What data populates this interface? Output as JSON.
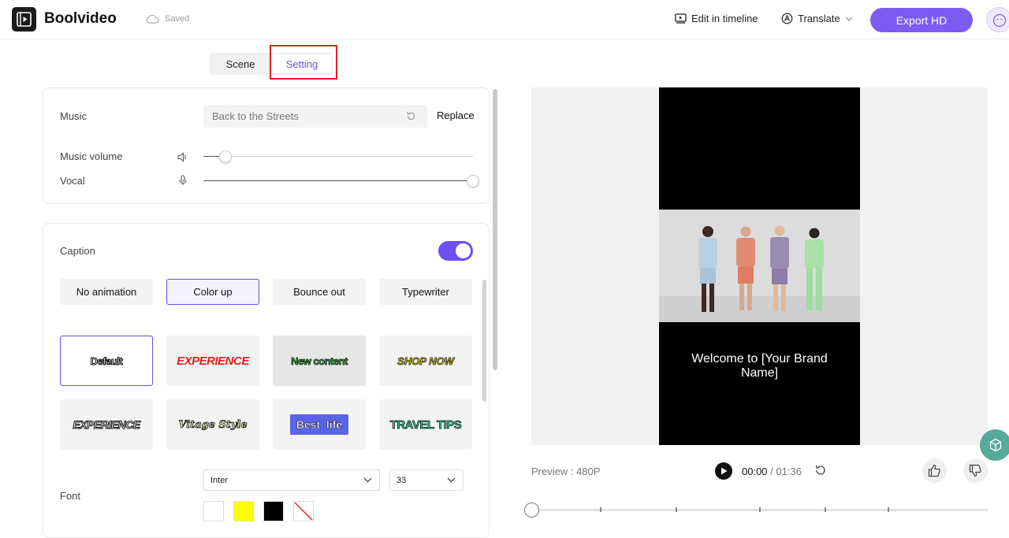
{
  "app": {
    "name": "Boolvideo",
    "save_status": "Saved"
  },
  "header": {
    "edit_timeline": "Edit in timeline",
    "translate": "Translate",
    "export": "Export HD"
  },
  "tabs": {
    "scene": "Scene",
    "setting": "Setting",
    "active": "Setting"
  },
  "music": {
    "label": "Music",
    "track": "Back to the Streets",
    "replace": "Replace",
    "volume_label": "Music volume",
    "volume_level": 0.08,
    "vocal_label": "Vocal",
    "vocal_level": 1.0
  },
  "caption": {
    "label": "Caption",
    "enabled": true,
    "animations": [
      "No animation",
      "Color up",
      "Bounce out",
      "Typewriter"
    ],
    "selected_animation": "Color up",
    "styles": [
      "Default",
      "EXPERIENCE",
      "New content",
      "SHOP NOW",
      "EXPERIENCE",
      "Vitage Style",
      "Best  life",
      "TRAVEL TIPS"
    ],
    "selected_style": "Default",
    "font_label": "Font",
    "font": "Inter",
    "font_size": "33",
    "colors": [
      "#ffffff",
      "#ffff00",
      "#000000",
      "none"
    ]
  },
  "preview": {
    "caption_text": "Welcome to [Your Brand Name]",
    "quality": "Preview : 480P",
    "current_time": "00:00",
    "separator": " / ",
    "total_time": "01:36"
  },
  "colors": {
    "accent": "#7b5cf0",
    "highlight": "#e02020"
  }
}
